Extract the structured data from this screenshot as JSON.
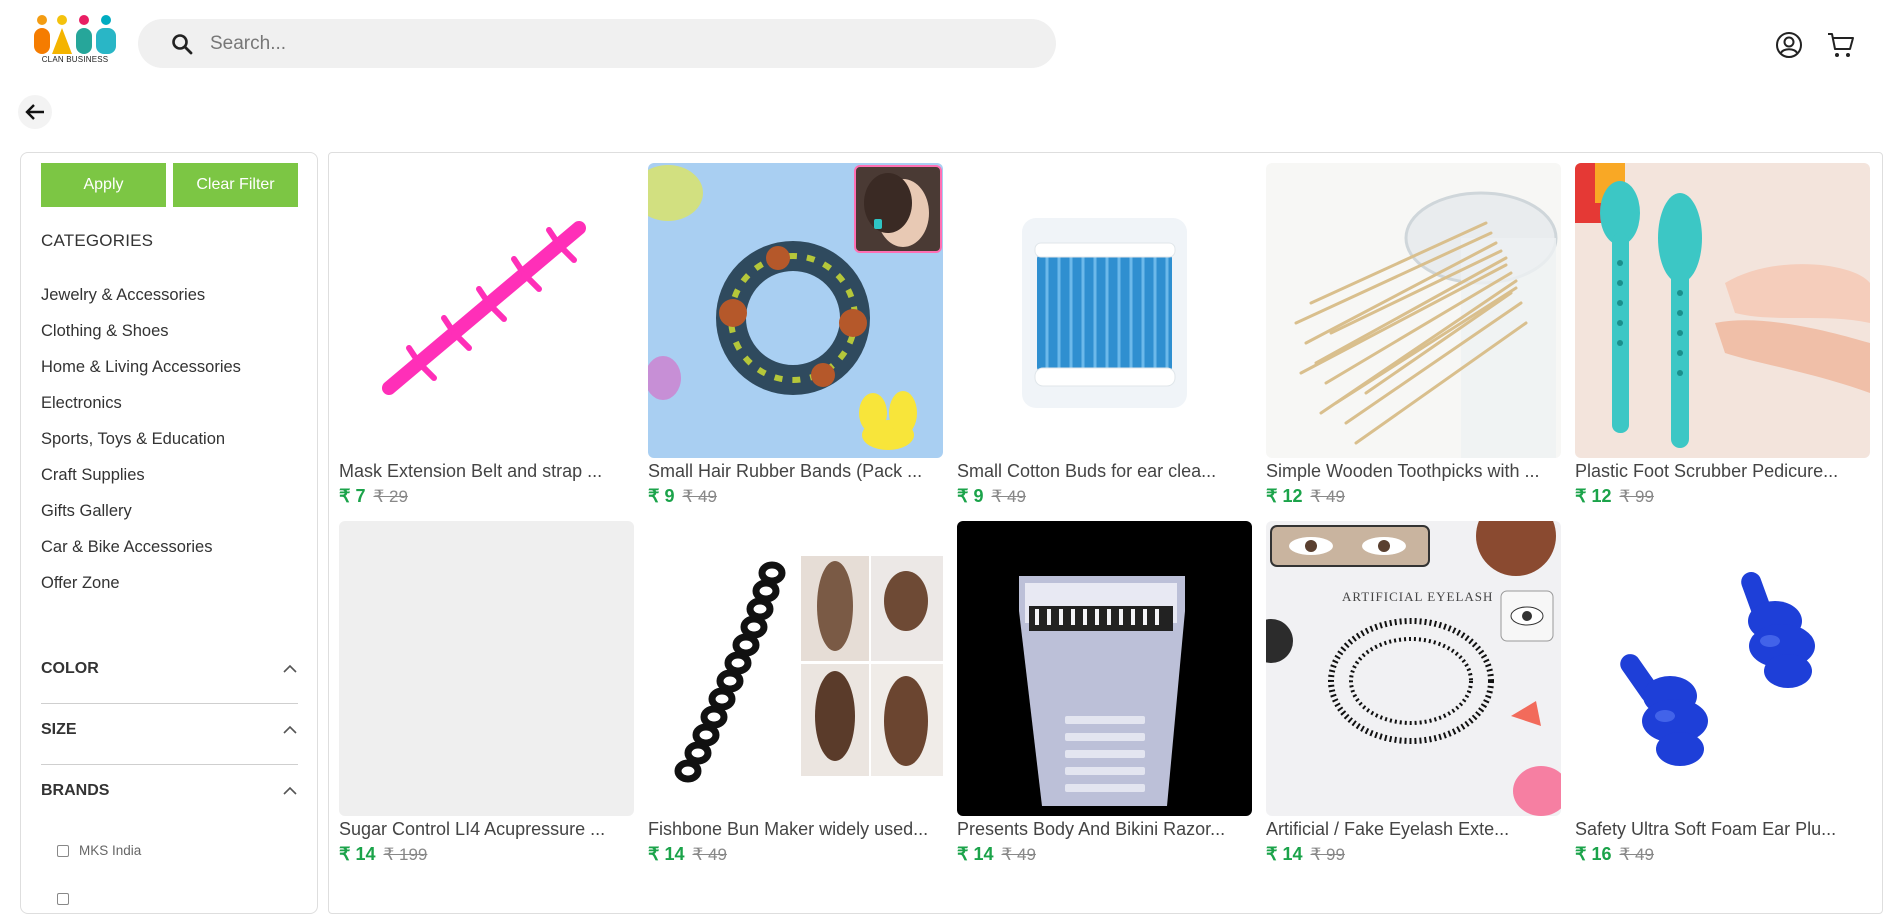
{
  "brand": {
    "logo_text": "CLAN BUSINESS"
  },
  "search": {
    "placeholder": "Search..."
  },
  "filters": {
    "apply_label": "Apply",
    "clear_label": "Clear Filter",
    "categories_title": "CATEGORIES",
    "categories": [
      "Jewelry & Accessories",
      "Clothing & Shoes",
      "Home & Living Accessories",
      "Electronics",
      "Sports, Toys & Education",
      "Craft Supplies",
      "Gifts Gallery",
      "Car & Bike Accessories",
      "Offer Zone"
    ],
    "color_label": "COLOR",
    "size_label": "SIZE",
    "brands_label": "BRANDS",
    "brands": [
      "MKS India"
    ]
  },
  "products": [
    {
      "name": "Mask Extension Belt and strap ...",
      "price": "₹ 7",
      "mrp": "₹ 29"
    },
    {
      "name": "Small Hair Rubber Bands (Pack ...",
      "price": "₹ 9",
      "mrp": "₹ 49"
    },
    {
      "name": "Small Cotton Buds for ear clea...",
      "price": "₹ 9",
      "mrp": "₹ 49"
    },
    {
      "name": "Simple Wooden Toothpicks with ...",
      "price": "₹ 12",
      "mrp": "₹ 49"
    },
    {
      "name": "Plastic Foot Scrubber Pedicure...",
      "price": "₹ 12",
      "mrp": "₹ 99"
    },
    {
      "name": "Sugar Control LI4 Acupressure ...",
      "price": "₹ 14",
      "mrp": "₹ 199"
    },
    {
      "name": "Fishbone Bun Maker widely used...",
      "price": "₹ 14",
      "mrp": "₹ 49"
    },
    {
      "name": "Presents Body And Bikini Razor...",
      "price": "₹ 14",
      "mrp": "₹ 49"
    },
    {
      "name": "Artificial / Fake Eyelash Exte...",
      "price": "₹ 14",
      "mrp": "₹ 99"
    },
    {
      "name": "Safety Ultra Soft Foam Ear Plu...",
      "price": "₹ 16",
      "mrp": "₹ 49"
    }
  ],
  "image_texts": {
    "eyelash_banner": "ARTIFICIAL EYELASH"
  },
  "colors": {
    "accent": "#7cc644",
    "price": "#1ba34a",
    "search_bg": "#f0f0f0"
  }
}
